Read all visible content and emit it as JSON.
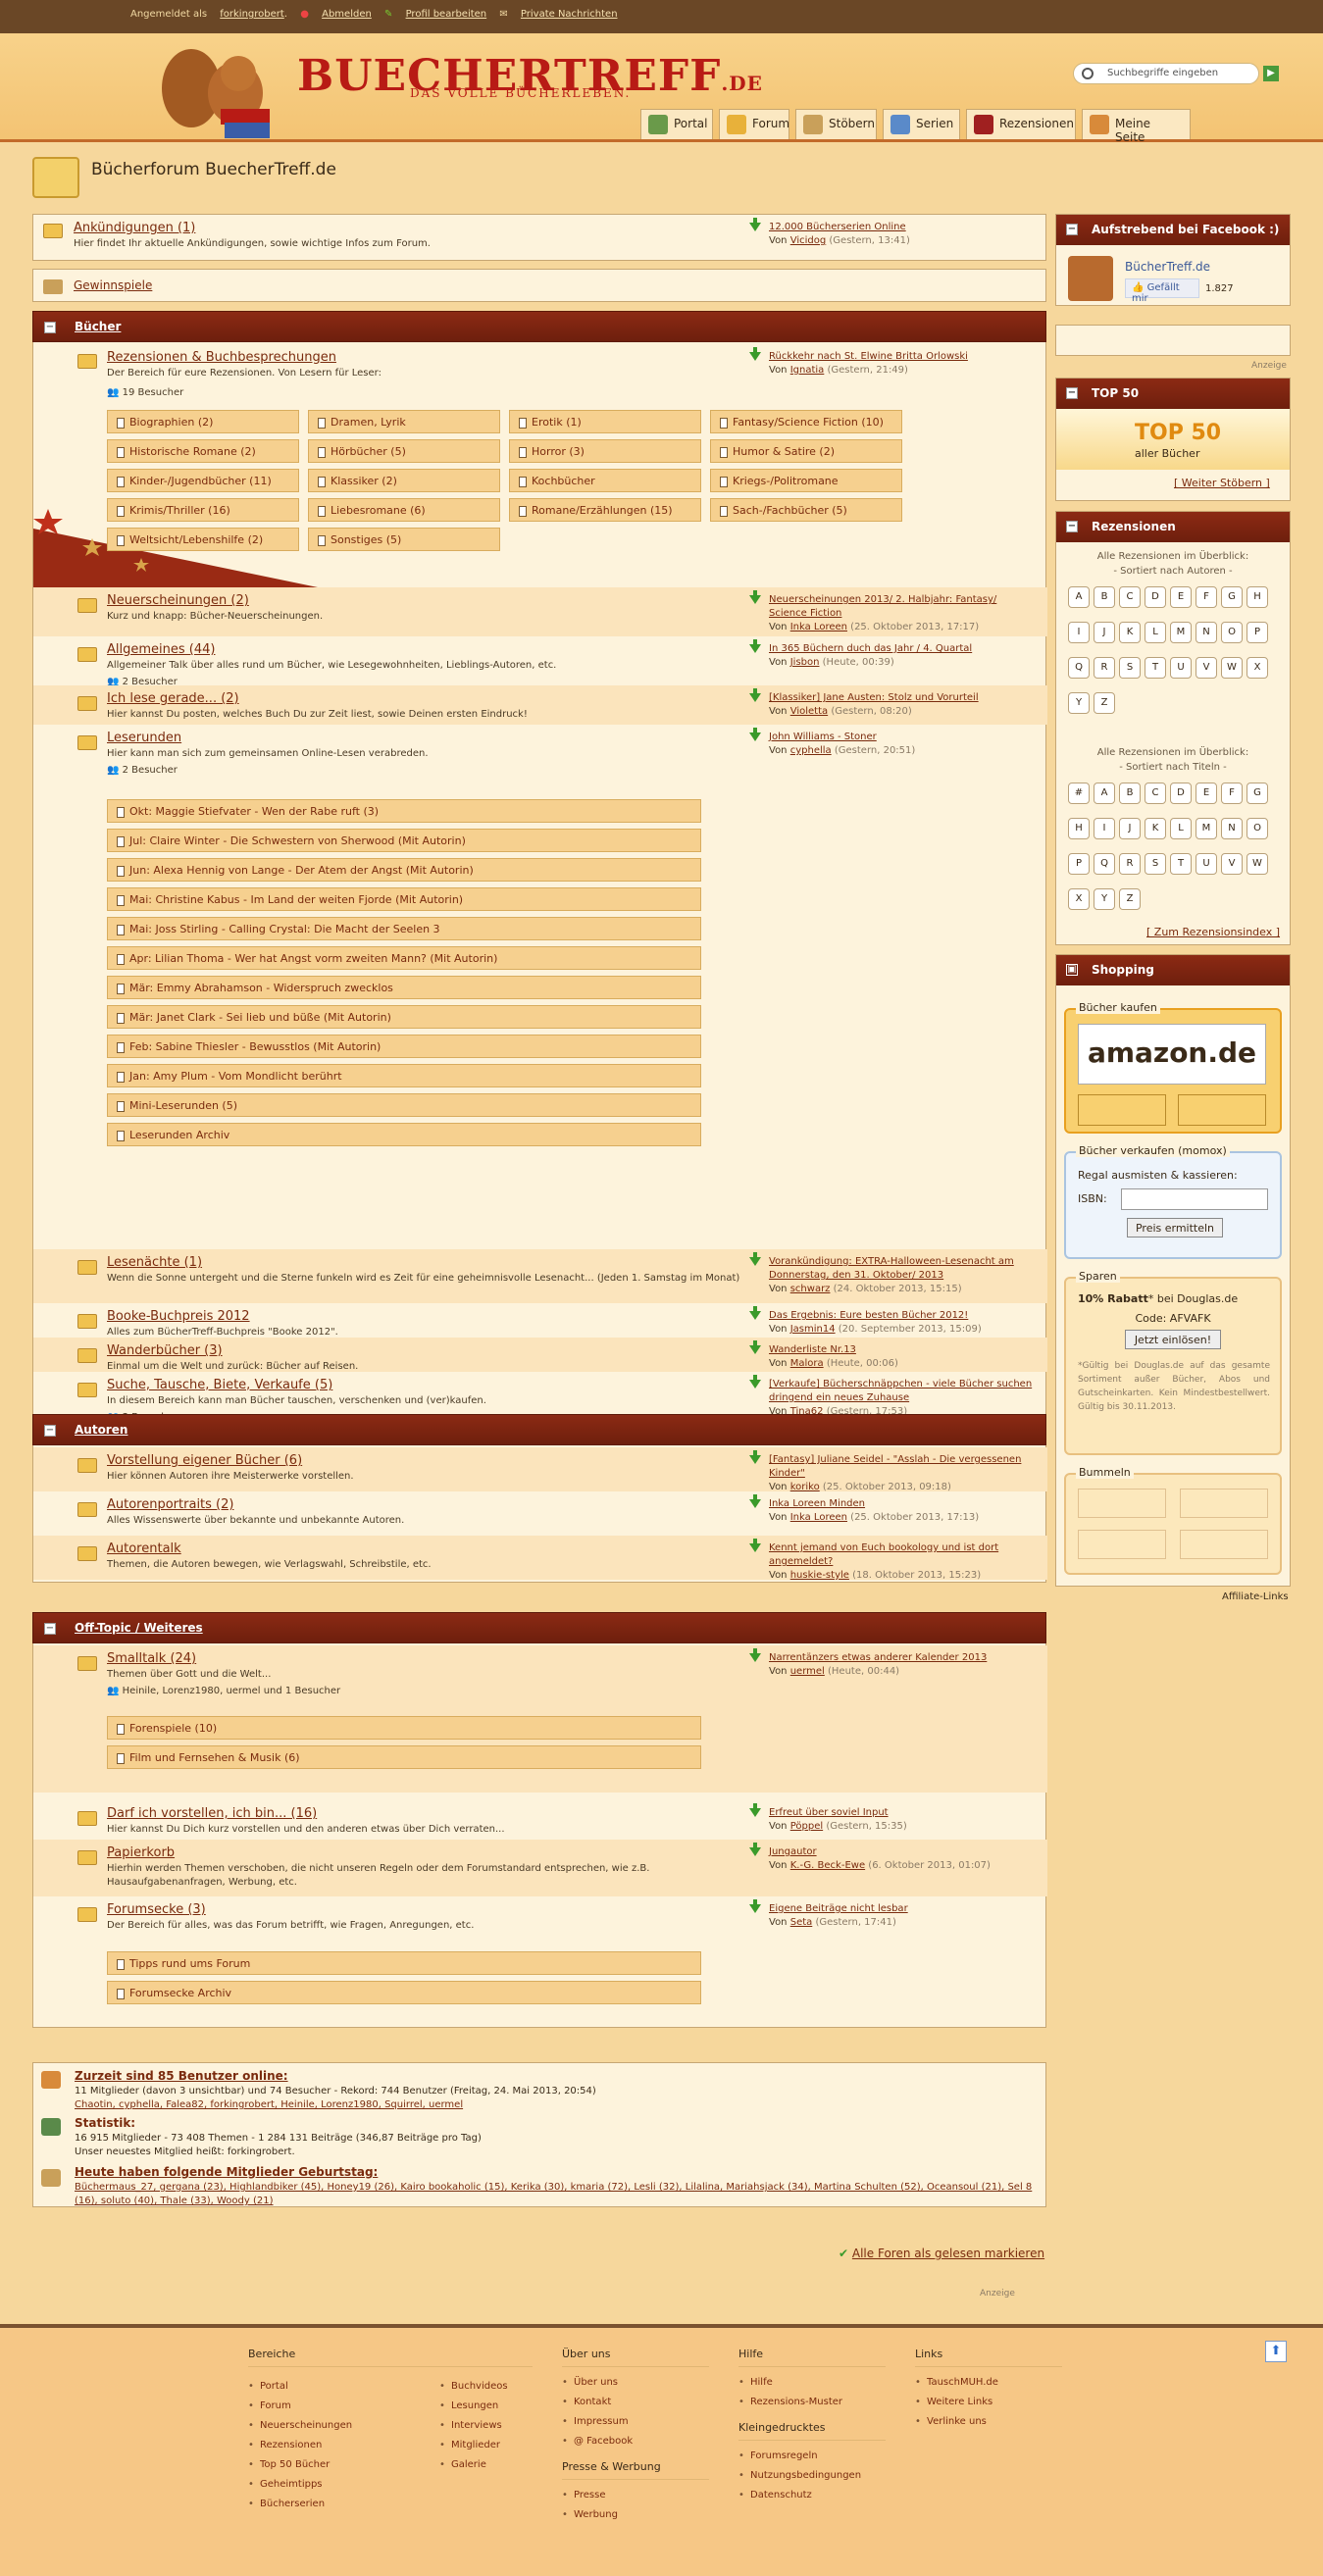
{
  "topbar": {
    "logged_in": "Angemeldet als",
    "user": "forkingrobert",
    "logout": "Abmelden",
    "profile": "Profil bearbeiten",
    "messages": "Private Nachrichten"
  },
  "header": {
    "logo_main": "BUECHERTREFF",
    "logo_tld": ".DE",
    "tagline": "DAS VOLLE BÜCHERLEBEN.",
    "search_placeholder": "Suchbegriffe eingeben"
  },
  "nav": [
    {
      "label": "Portal"
    },
    {
      "label": "Forum"
    },
    {
      "label": "Stöbern"
    },
    {
      "label": "Serien"
    },
    {
      "label": "Rezensionen"
    },
    {
      "label": "Meine Seite"
    }
  ],
  "page_title": "Bücherforum BuecherTreff.de",
  "announce": {
    "title": "Ankündigungen (1)",
    "desc": "Hier findet Ihr aktuelle Ankündigungen, sowie wichtige Infos zum Forum.",
    "lp_title": "12.000 Bücherserien Online",
    "lp_by": "Von",
    "lp_user": "Vicidog",
    "lp_date": "(Gestern, 13:41)"
  },
  "gewinnspiele": "Gewinnspiele",
  "cat_buecher": "Bücher",
  "rezensionen": {
    "title": "Rezensionen & Buchbesprechungen",
    "desc": "Der Bereich für eure Rezensionen. Von Lesern für Leser:",
    "visitors": "19 Besucher",
    "lp_title": "Rückkehr nach St. Elwine Britta Orlowski",
    "lp_user": "Ignatia",
    "lp_date": "(Gestern, 21:49)"
  },
  "genres": [
    "Biographien (2)",
    "Dramen, Lyrik",
    "Erotik (1)",
    "Fantasy/Science Fiction (10)",
    "Historische Romane (2)",
    "Hörbücher (5)",
    "Horror (3)",
    "Humor & Satire (2)",
    "Kinder-/Jugendbücher (11)",
    "Klassiker (2)",
    "Kochbücher",
    "Kriegs-/Politromane",
    "Krimis/Thriller (16)",
    "Liebesromane (6)",
    "Romane/Erzählungen (15)",
    "Sach-/Fachbücher (5)",
    "Weltsicht/Lebenshilfe (2)",
    "Sonstiges (5)"
  ],
  "forums_b": [
    {
      "title": "Neuerscheinungen (2)",
      "desc": "Kurz und knapp: Bücher-Neuerscheinungen.",
      "visitors": "",
      "lp1": "Neuerscheinungen 2013/ 2. Halbjahr: Fantasy/",
      "lp2": "Science Fiction",
      "user": "Inka Loreen",
      "date": "(25. Oktober 2013, 17:17)"
    },
    {
      "title": "Allgemeines (44)",
      "desc": "Allgemeiner Talk über alles rund um Bücher, wie Lesegewohnheiten, Lieblings-Autoren, etc.",
      "visitors": "2 Besucher",
      "lp1": "In 365 Büchern duch das Jahr / 4. Quartal",
      "lp2": "",
      "user": "Jisbon",
      "date": "(Heute, 00:39)"
    },
    {
      "title": "Ich lese gerade... (2)",
      "desc": "Hier kannst Du posten, welches Buch Du zur Zeit liest, sowie Deinen ersten Eindruck!",
      "visitors": "",
      "lp1": "[Klassiker] Jane Austen: Stolz und Vorurteil",
      "lp2": "",
      "user": "Violetta",
      "date": "(Gestern, 08:20)"
    },
    {
      "title": "Leserunden",
      "desc": "Hier kann man sich zum gemeinsamen Online-Lesen verabreden.",
      "visitors": "2 Besucher",
      "lp1": "John Williams - Stoner",
      "lp2": "",
      "user": "cyphella",
      "date": "(Gestern, 20:51)"
    }
  ],
  "leserunden": [
    "Okt: Maggie Stiefvater - Wen der Rabe ruft (3)",
    "Jul: Claire Winter - Die Schwestern von Sherwood (Mit Autorin)",
    "Jun: Alexa Hennig von Lange - Der Atem der Angst (Mit Autorin)",
    "Mai: Christine Kabus - Im Land der weiten Fjorde (Mit Autorin)",
    "Mai: Joss Stirling - Calling Crystal: Die Macht der Seelen 3",
    "Apr: Lilian Thoma - Wer hat Angst vorm zweiten Mann? (Mit Autorin)",
    "Mär: Emmy Abrahamson - Widerspruch zwecklos",
    "Mär: Janet Clark - Sei lieb und büße (Mit Autorin)",
    "Feb: Sabine Thiesler - Bewusstlos (Mit Autorin)",
    "Jan: Amy Plum - Vom Mondlicht berührt",
    "Mini-Leserunden (5)",
    "Leserunden Archiv"
  ],
  "forums_b2": [
    {
      "title": "Lesenächte (1)",
      "desc": "Wenn die Sonne untergeht und die Sterne funkeln wird es Zeit für eine geheimnisvolle Lesenacht... (Jeden 1. Samstag im Monat)",
      "visitors": "",
      "lp1": "Vorankündigung: EXTRA-Halloween-Lesenacht am",
      "lp2": "Donnerstag, den 31. Oktober/ 2013",
      "user": "schwarz",
      "date": "(24. Oktober 2013, 15:15)"
    },
    {
      "title": "Booke-Buchpreis 2012",
      "desc": "Alles zum BücherTreff-Buchpreis \"Booke 2012\".",
      "visitors": "",
      "lp1": "Das Ergebnis: Eure besten Bücher 2012!",
      "lp2": "",
      "user": "Jasmin14",
      "date": "(20. September 2013, 15:09)"
    },
    {
      "title": "Wanderbücher (3)",
      "desc": "Einmal um die Welt und zurück: Bücher auf Reisen.",
      "visitors": "",
      "lp1": "Wanderliste Nr.13",
      "lp2": "",
      "user": "Malora",
      "date": "(Heute, 00:06)"
    },
    {
      "title": "Suche, Tausche, Biete, Verkaufe (5)",
      "desc": "In diesem Bereich kann man Bücher tauschen, verschenken und (ver)kaufen.",
      "visitors": "3 Besucher",
      "lp1": "[Verkaufe] Bücherschnäppchen - viele Bücher suchen",
      "lp2": "dringend ein neues Zuhause",
      "user": "Tina62",
      "date": "(Gestern, 17:53)"
    }
  ],
  "cat_autoren": "Autoren",
  "forums_a": [
    {
      "title": "Vorstellung eigener Bücher (6)",
      "desc": "Hier können Autoren ihre Meisterwerke vorstellen.",
      "lp1": "[Fantasy] Juliane Seidel - \"Asslah - Die vergessenen",
      "lp2": "Kinder\"",
      "user": "koriko",
      "date": "(25. Oktober 2013, 09:18)"
    },
    {
      "title": "Autorenportraits (2)",
      "desc": "Alles Wissenswerte über bekannte und unbekannte Autoren.",
      "lp1": "Inka Loreen Minden",
      "lp2": "",
      "user": "Inka Loreen",
      "date": "(25. Oktober 2013, 17:13)"
    },
    {
      "title": "Autorentalk",
      "desc": "Themen, die Autoren bewegen, wie Verlagswahl, Schreibstile, etc.",
      "lp1": "Kennt jemand von Euch bookology und ist dort",
      "lp2": "angemeldet?",
      "user": "huskie-style",
      "date": "(18. Oktober 2013, 15:23)"
    }
  ],
  "cat_offtopic": "Off-Topic / Weiteres",
  "smalltalk": {
    "title": "Smalltalk (24)",
    "desc": "Themen über Gott und die Welt...",
    "visitors": "Heinile, Lorenz1980, uermel und 1 Besucher",
    "lp1": "Narrentänzers etwas anderer Kalender 2013",
    "user": "uermel",
    "date": "(Heute, 00:44)",
    "subs": [
      "Forenspiele (10)",
      "Film und Fernsehen & Musik (6)"
    ]
  },
  "forums_o": [
    {
      "title": "Darf ich vorstellen, ich bin... (16)",
      "desc": "Hier kannst Du Dich kurz vorstellen und den anderen etwas über Dich verraten...",
      "lp1": "Erfreut über soviel Input",
      "user": "Pöppel",
      "date": "(Gestern, 15:35)"
    },
    {
      "title": "Papierkorb",
      "desc": "Hierhin werden Themen verschoben, die nicht unseren Regeln oder dem Forumstandard entsprechen, wie z.B.",
      "desc2": "Hausaufgabenanfragen, Werbung, etc.",
      "lp1": "Jungautor",
      "user": "K.-G. Beck-Ewe",
      "date": "(6. Oktober 2013, 01:07)"
    },
    {
      "title": "Forumsecke (3)",
      "desc": "Der Bereich für alles, was das Forum betrifft, wie Fragen, Anregungen, etc.",
      "lp1": "Eigene Beiträge nicht lesbar",
      "user": "Seta",
      "date": "(Gestern, 17:41)",
      "subs": [
        "Tipps rund ums Forum",
        "Forumsecke Archiv"
      ]
    }
  ],
  "lp_by": "Von",
  "online": {
    "title": "Zurzeit sind 85 Benutzer online:",
    "line1": "11 Mitglieder (davon 3 unsichtbar) und 74 Besucher - Rekord: 744 Benutzer (Freitag, 24. Mai 2013, 20:54)",
    "line2": "Chaotin, cyphella, Falea82, forkingrobert, Heinile, Lorenz1980, Squirrel, uermel"
  },
  "stats": {
    "title": "Statistik:",
    "line1": "16 915 Mitglieder - 73 408 Themen - 1 284 131 Beiträge (346,87 Beiträge pro Tag)",
    "line2": "Unser neuestes Mitglied heißt: forkingrobert."
  },
  "birthday": {
    "title": "Heute haben folgende Mitglieder Geburtstag:",
    "line1": "Büchermaus_27, gergana (23), Highlandbiker (45), Honey19 (26), Kairo bookaholic (15), Kerika (30), kmaria (72), Lesli (32), Lilalina, Mariahsjack (34), Martina Schulten (52), Oceansoul (21), Sel 8",
    "line2": "(16), soluto (40), Thale (33), Woody (21)"
  },
  "mark_read": "Alle Foren als gelesen markieren",
  "anzeige": "Anzeige",
  "side": {
    "fb_head": "Aufstrebend bei Facebook :)",
    "fb_name": "BücherTreff.de",
    "fb_like": "Gefällt mir",
    "fb_count": "1.827",
    "top50_head": "TOP 50",
    "top50_big": "TOP 50",
    "top50_sub": "aller Bücher",
    "top50_link": "[ Weiter Stöbern ]",
    "rez_head": "Rezensionen",
    "rez_l1": "Alle Rezensionen im Überblick:",
    "rez_l2": "- Sortiert nach Autoren -",
    "rez_l3": "Alle Rezensionen im Überblick:",
    "rez_l4": "- Sortiert nach Titeln -",
    "rez_link": "[ Zum Rezensionsindex ]",
    "letters1": [
      "A",
      "B",
      "C",
      "D",
      "E",
      "F",
      "G",
      "H",
      "I",
      "J",
      "K",
      "L",
      "M",
      "N",
      "O",
      "P",
      "Q",
      "R",
      "S",
      "T",
      "U",
      "V",
      "W",
      "X",
      "Y",
      "Z"
    ],
    "letters2": [
      "#",
      "A",
      "B",
      "C",
      "D",
      "E",
      "F",
      "G",
      "H",
      "I",
      "J",
      "K",
      "L",
      "M",
      "N",
      "O",
      "P",
      "Q",
      "R",
      "S",
      "T",
      "U",
      "V",
      "W",
      "X",
      "Y",
      "Z"
    ],
    "shop_head": "Shopping",
    "buy": "Bücher kaufen",
    "amazon": "amazon.de",
    "sell": "Bücher verkaufen (momox)",
    "sell_desc": "Regal ausmisten & kassieren:",
    "isbn": "ISBN:",
    "price_btn": "Preis ermitteln",
    "save": "Sparen",
    "rabatt": "10% Rabatt",
    "rabatt2": "* bei Douglas.de",
    "code": "Code: AFVAFK",
    "redeem": "Jetzt einlösen!",
    "fine": "*Gültig bei Douglas.de auf das gesamte Sortiment außer Bücher, Abos und Gutscheinkarten. Kein Mindestbestellwert. Gültig bis 30.11.2013.",
    "bummeln": "Bummeln",
    "affiliate": "Affiliate-Links",
    "anzeige": "Anzeige"
  },
  "footer": {
    "bereiche": "Bereiche",
    "b1": [
      "Portal",
      "Forum",
      "Neuerscheinungen",
      "Rezensionen",
      "Top 50 Bücher",
      "Geheimtipps",
      "Bücherserien"
    ],
    "b2": [
      "Buchvideos",
      "Lesungen",
      "Interviews",
      "Mitglieder",
      "Galerie"
    ],
    "ueber": "Über uns",
    "u": [
      "Über uns",
      "Kontakt",
      "Impressum",
      "@ Facebook"
    ],
    "presse": "Presse & Werbung",
    "p": [
      "Presse",
      "Werbung"
    ],
    "hilfe": "Hilfe",
    "h": [
      "Hilfe",
      "Rezensions-Muster"
    ],
    "klein": "Kleingedrucktes",
    "k": [
      "Forumsregeln",
      "Nutzungsbedingungen",
      "Datenschutz"
    ],
    "links": "Links",
    "l": [
      "TauschMUH.de",
      "Weitere Links",
      "Verlinke uns"
    ]
  }
}
